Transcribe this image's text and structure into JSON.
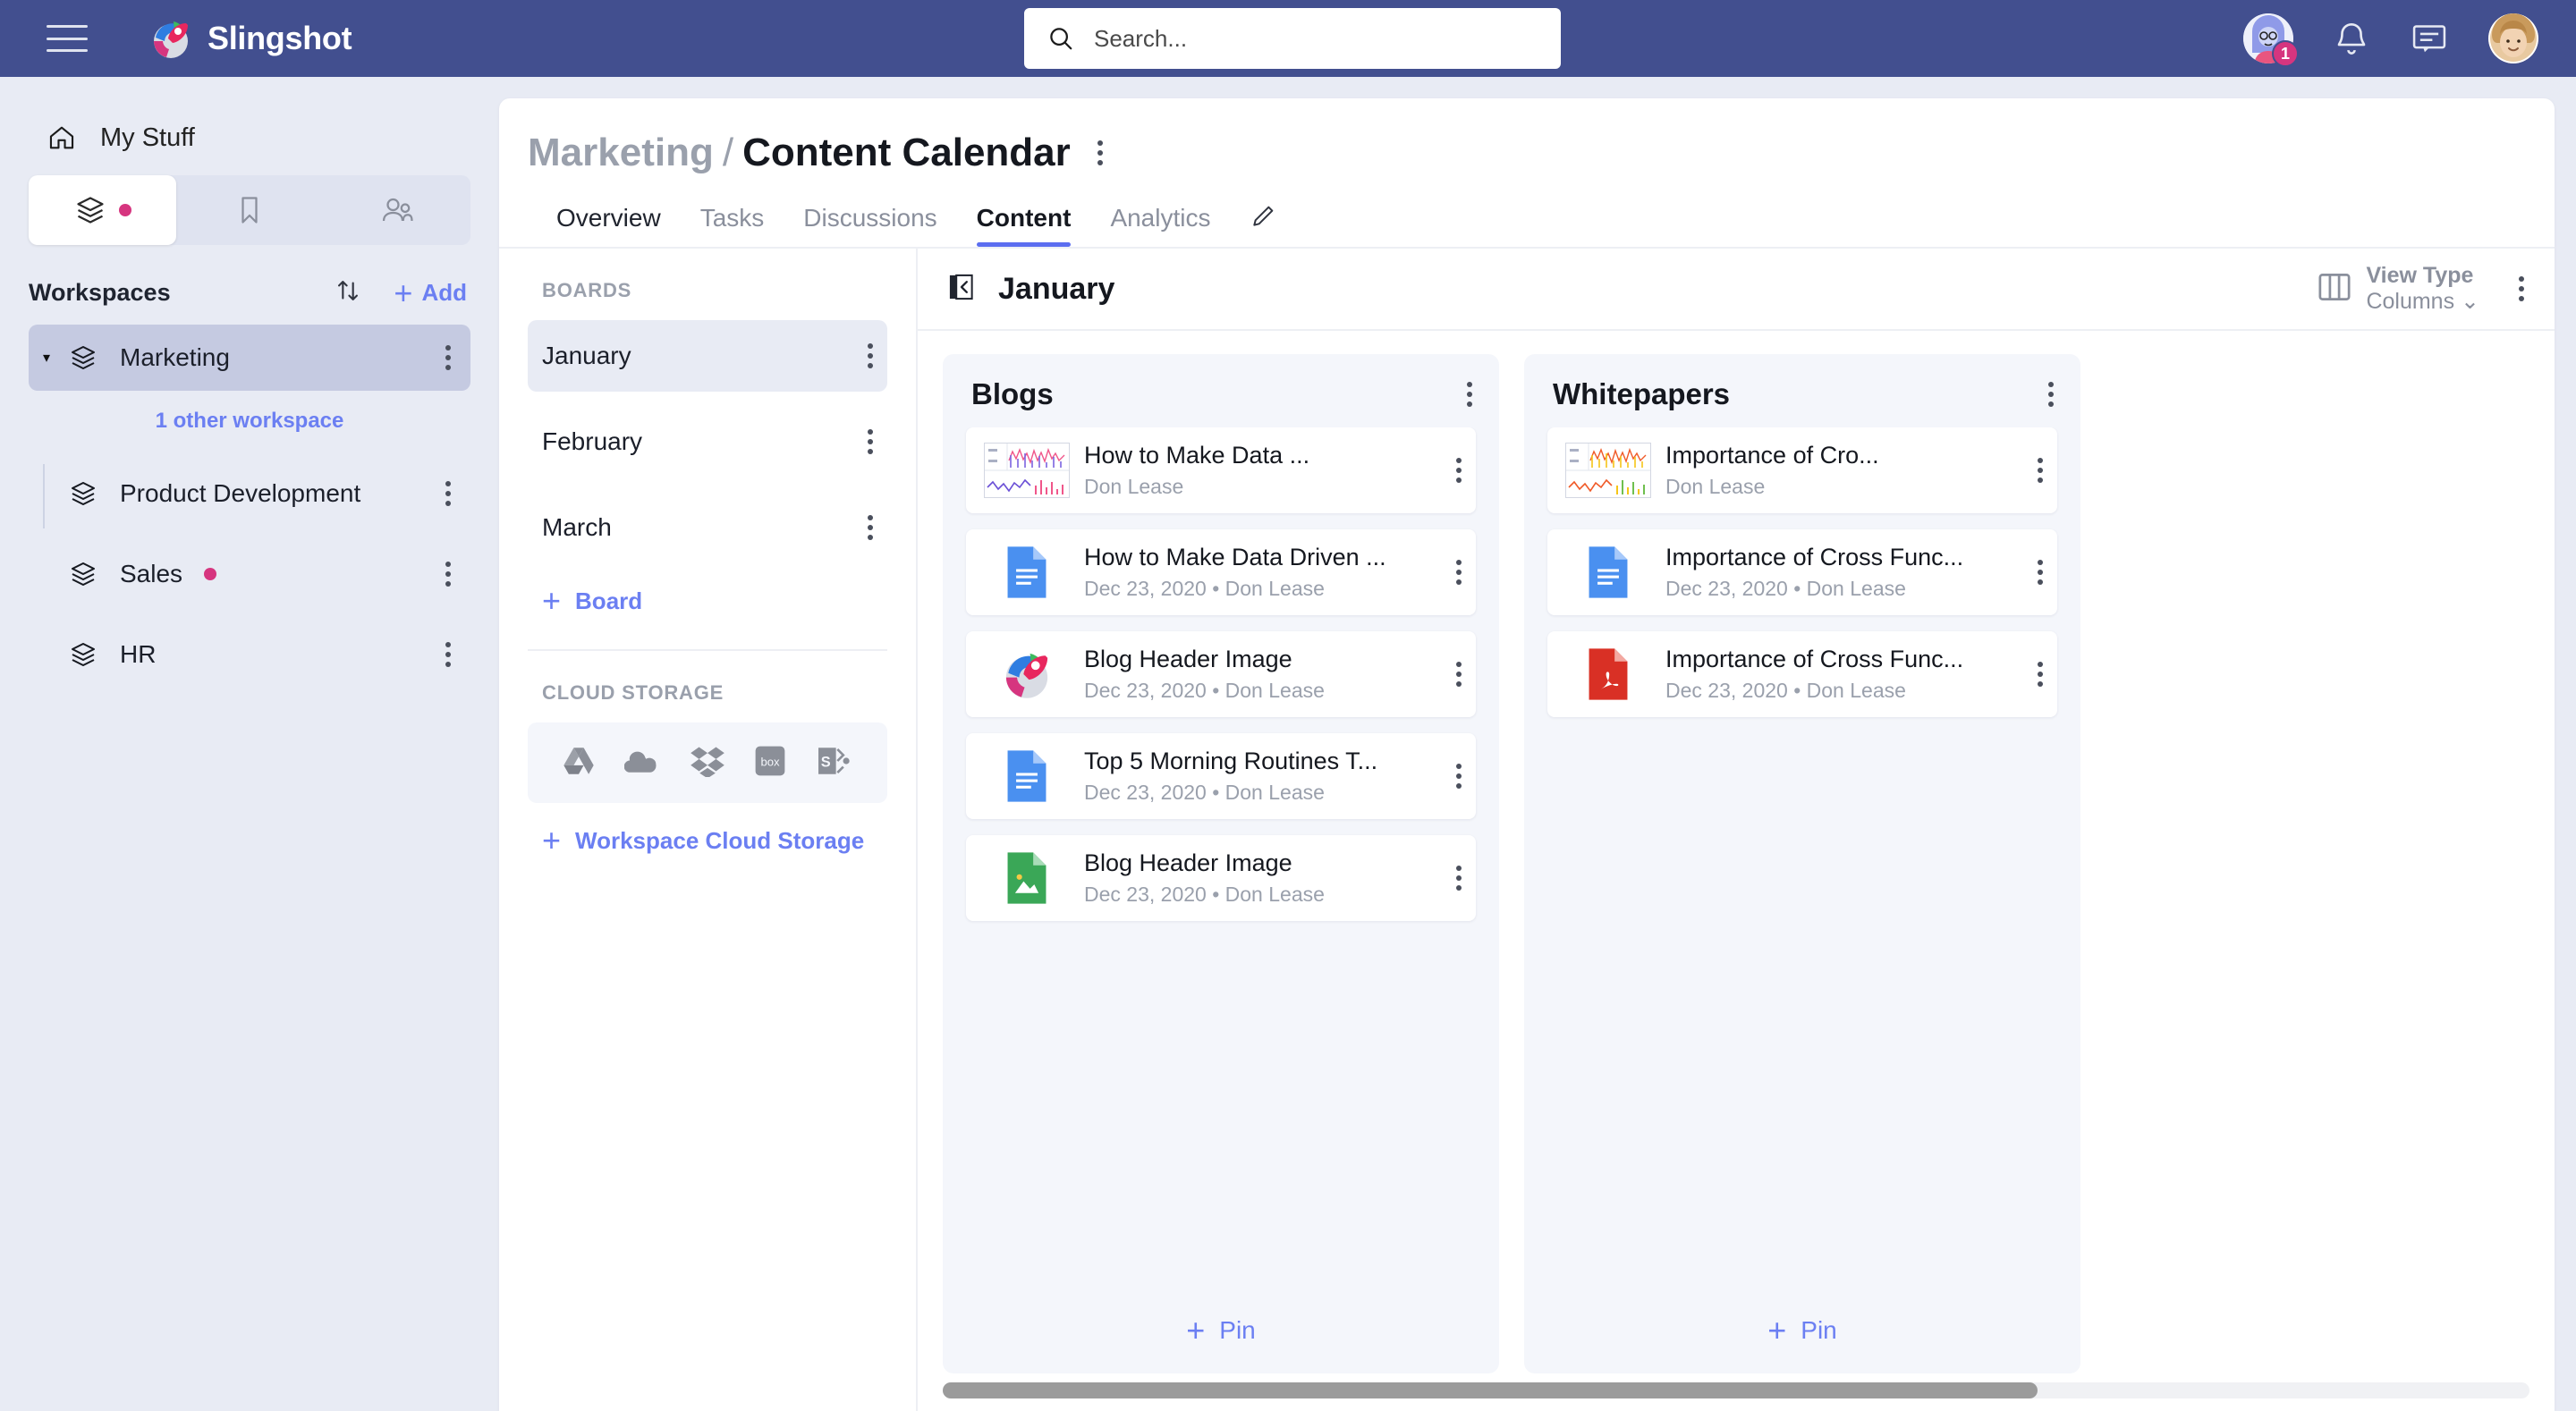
{
  "topbar": {
    "menu_icon": "hamburger-icon",
    "brand": "Slingshot",
    "search_placeholder": "Search...",
    "search_value": "",
    "assistant_badge": "1",
    "bell_icon": "bell-icon",
    "chat_icon": "chat-icon"
  },
  "sidebar": {
    "my_stuff": "My Stuff",
    "tabs": [
      {
        "name": "workspaces-tab",
        "icon": "layers-icon",
        "active": true,
        "dot": true
      },
      {
        "name": "bookmarks-tab",
        "icon": "bookmark-icon",
        "active": false,
        "dot": false
      },
      {
        "name": "people-tab",
        "icon": "people-icon",
        "active": false,
        "dot": false
      }
    ],
    "workspaces_label": "Workspaces",
    "sort_icon": "sort-arrows-icon",
    "add_label": "Add",
    "selected_workspace": "Marketing",
    "other_workspaces_link": "1 other workspace",
    "items": [
      {
        "label": "Product Development",
        "dot": false
      },
      {
        "label": "Sales",
        "dot": true
      },
      {
        "label": "HR",
        "dot": false
      }
    ]
  },
  "page": {
    "breadcrumb_workspace": "Marketing",
    "breadcrumb_separator": "/",
    "breadcrumb_page": "Content Calendar",
    "tabs": [
      {
        "label": "Overview",
        "active": false,
        "dark": true
      },
      {
        "label": "Tasks",
        "active": false,
        "dark": false
      },
      {
        "label": "Discussions",
        "active": false,
        "dark": false
      },
      {
        "label": "Content",
        "active": true,
        "dark": false
      },
      {
        "label": "Analytics",
        "active": false,
        "dark": false
      }
    ],
    "edit_icon": "pencil-icon"
  },
  "boards_panel": {
    "boards_label": "BOARDS",
    "boards": [
      {
        "label": "January",
        "selected": true
      },
      {
        "label": "February",
        "selected": false
      },
      {
        "label": "March",
        "selected": false
      }
    ],
    "add_board_label": "Board",
    "cloud_label": "CLOUD STORAGE",
    "cloud_icons": [
      "google-drive-icon",
      "onedrive-icon",
      "dropbox-icon",
      "box-icon",
      "sharepoint-icon"
    ],
    "add_cloud_label": "Workspace Cloud Storage"
  },
  "board": {
    "collapse_icon": "collapse-panel-icon",
    "title": "January",
    "view_type_label": "View Type",
    "view_type_value": "Columns",
    "view_type_icon": "columns-icon",
    "columns": [
      {
        "title": "Blogs",
        "pin_label": "Pin",
        "cards": [
          {
            "title": "How to Make Data ...",
            "subtitle": "Don Lease",
            "icon": "chart-thumbnail",
            "icon_variant": "pink"
          },
          {
            "title": "How to Make Data Driven ...",
            "subtitle": "Dec 23, 2020 • Don Lease",
            "icon": "google-docs-icon"
          },
          {
            "title": "Blog Header Image",
            "subtitle": "Dec 23, 2020 • Don Lease",
            "icon": "slingshot-icon"
          },
          {
            "title": "Top 5 Morning Routines T...",
            "subtitle": "Dec 23, 2020 • Don Lease",
            "icon": "google-docs-icon"
          },
          {
            "title": "Blog Header Image",
            "subtitle": "Dec 23, 2020 • Don Lease",
            "icon": "image-file-icon"
          }
        ]
      },
      {
        "title": "Whitepapers",
        "pin_label": "Pin",
        "cards": [
          {
            "title": "Importance of Cro...",
            "subtitle": "Don Lease",
            "icon": "chart-thumbnail",
            "icon_variant": "orange"
          },
          {
            "title": "Importance of Cross Func...",
            "subtitle": "Dec 23, 2020 • Don Lease",
            "icon": "google-docs-icon"
          },
          {
            "title": "Importance of Cross Func...",
            "subtitle": "Dec 23, 2020 • Don Lease",
            "icon": "pdf-file-icon"
          }
        ]
      }
    ]
  },
  "colors": {
    "header_bg": "#424f8f",
    "accent_blue": "#5b6ef0",
    "link_blue": "#6b7ff2",
    "pink_dot": "#d6357f",
    "sidebar_bg": "#e8ebf4"
  }
}
